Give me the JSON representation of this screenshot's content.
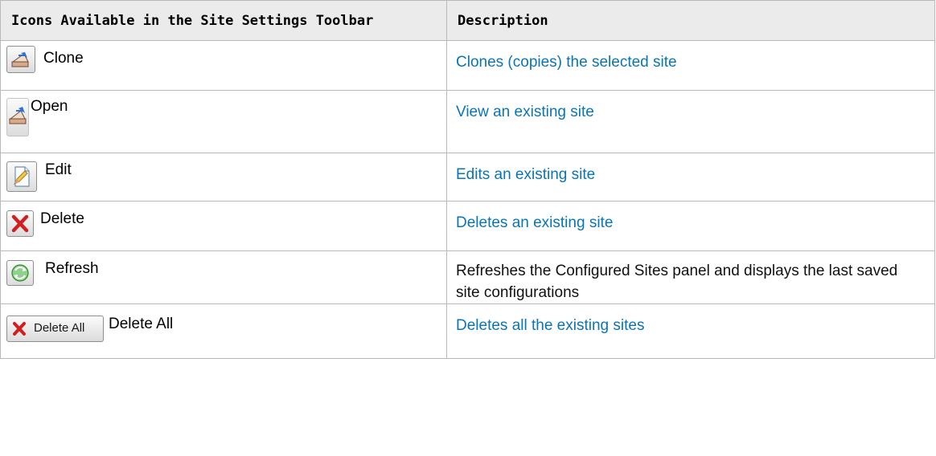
{
  "table": {
    "header": {
      "icons_col": "Icons Available in the Site Settings Toolbar",
      "desc_col": "Description"
    },
    "rows": [
      {
        "icon": "clone-icon",
        "label": "Clone",
        "description": "Clones (copies) the selected site",
        "desc_style": "link"
      },
      {
        "icon": "open-icon",
        "label": "Open",
        "description": "View an existing site",
        "desc_style": "link"
      },
      {
        "icon": "edit-icon",
        "label": "Edit",
        "description": "Edits an existing site",
        "desc_style": "link"
      },
      {
        "icon": "delete-icon",
        "label": "Delete",
        "description": "Deletes an existing site",
        "desc_style": "link"
      },
      {
        "icon": "refresh-icon",
        "label": "Refresh",
        "description": "Refreshes the Configured Sites panel and displays the last saved site configurations",
        "desc_style": "plain"
      },
      {
        "icon": "delete-all-icon",
        "label": "Delete All",
        "button_text": "Delete All",
        "description": "Deletes all the existing sites",
        "desc_style": "link"
      }
    ]
  },
  "colors": {
    "link": "#0a74b8",
    "header_bg": "#ebebeb",
    "border": "#b9b9b9",
    "delete_red": "#d11f1f",
    "refresh_green": "#3aa535"
  }
}
